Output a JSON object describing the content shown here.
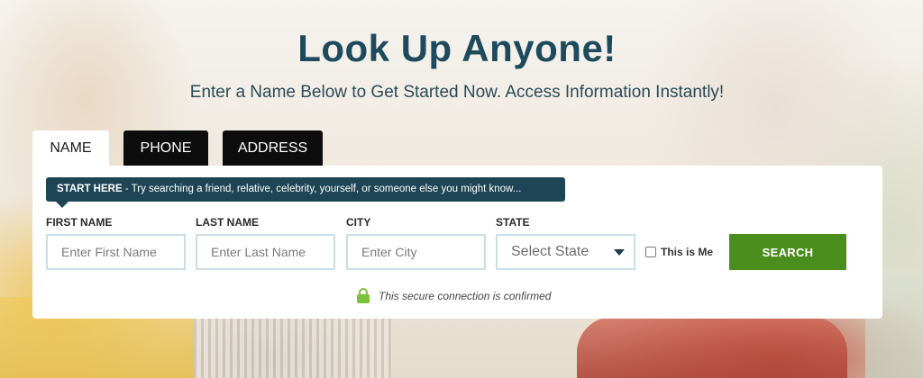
{
  "hero": {
    "title": "Look Up Anyone!",
    "subtitle": "Enter a Name Below to Get Started Now. Access Information Instantly!"
  },
  "tabs": [
    {
      "label": "NAME",
      "active": true
    },
    {
      "label": "PHONE",
      "active": false
    },
    {
      "label": "ADDRESS",
      "active": false
    }
  ],
  "hint": {
    "lead": "START HERE",
    "text": " - Try searching a friend, relative, celebrity, yourself, or someone else you might know..."
  },
  "form": {
    "first_name": {
      "label": "FIRST NAME",
      "placeholder": "Enter First Name"
    },
    "last_name": {
      "label": "LAST NAME",
      "placeholder": "Enter Last Name"
    },
    "city": {
      "label": "CITY",
      "placeholder": "Enter City"
    },
    "state": {
      "label": "STATE",
      "selected": "Select State"
    },
    "this_is_me": {
      "label": "This is Me",
      "checked": false
    },
    "search_label": "SEARCH"
  },
  "secure": {
    "text": "This secure connection is confirmed",
    "icon": "lock-icon"
  },
  "colors": {
    "title": "#1d4a5c",
    "hint_bg": "#1e4556",
    "search_bg": "#4b8e1e",
    "lock": "#7cc13a",
    "tab_dark": "#0d0d0d"
  }
}
